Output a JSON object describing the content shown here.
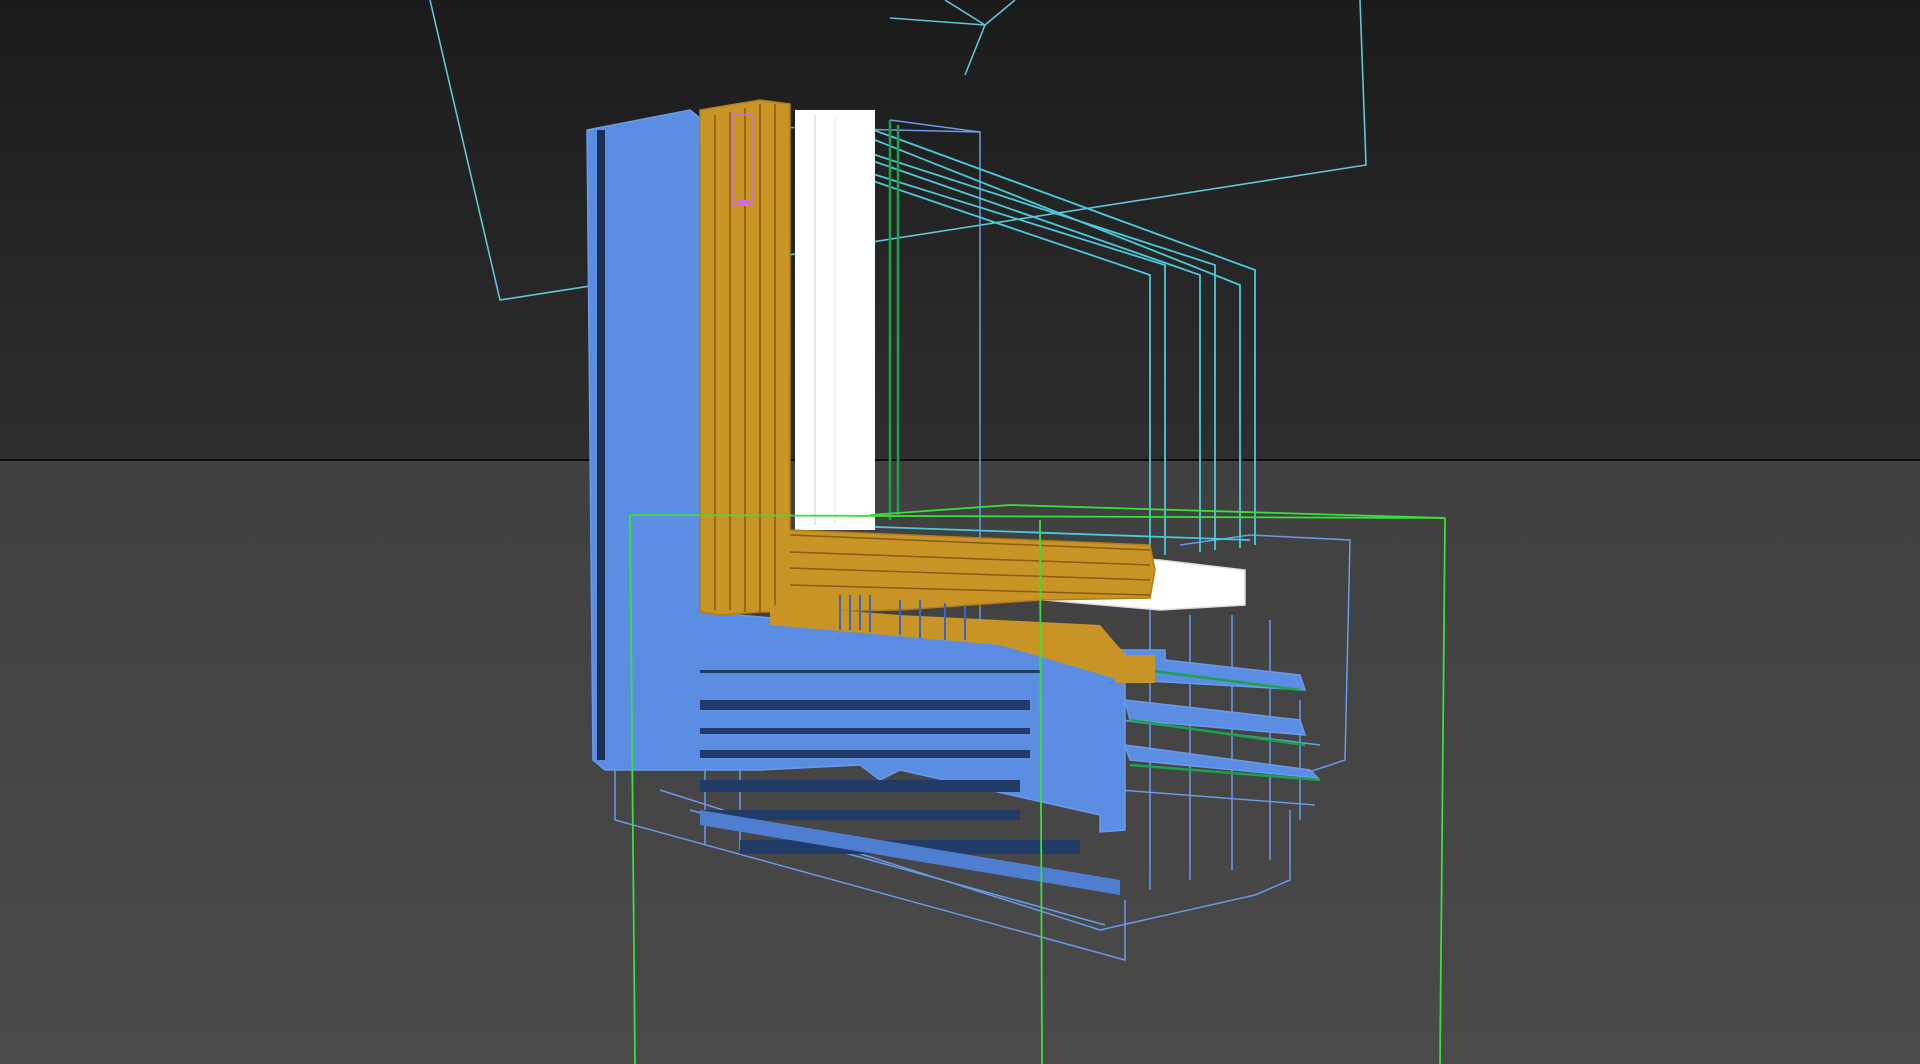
{
  "viewport": {
    "view_mode": "perspective",
    "shading": "wireframe-over-shaded",
    "horizon_grid": true
  },
  "colors": {
    "sky_top": "#1b1b1b",
    "sky_bottom": "#2e2e2e",
    "ground_top": "#404040",
    "ground_bottom": "#4a4a4a",
    "horizon_line": "#0c0c0c",
    "frame_profile": "#5b8ee2",
    "frame_edges": "#6a9ae8",
    "sash_gold": "#c99426",
    "sash_dark_gold": "#8a5a10",
    "glazing_white": "#ffffff",
    "glass_edges": "#49c9dc",
    "gasket_green": "#1aa34a",
    "selection_box": "#39e039",
    "camera_gizmo": "#5fc6d8",
    "accent_pink": "#d26fd8"
  },
  "scene_objects": [
    {
      "name": "window-frame-profile",
      "color": "frame_profile"
    },
    {
      "name": "sash-profile",
      "color": "sash_gold"
    },
    {
      "name": "glazing-unit",
      "color": "glazing_white"
    },
    {
      "name": "glass-panes",
      "color": "glass_edges"
    },
    {
      "name": "gaskets",
      "color": "gasket_green"
    },
    {
      "name": "selection-bounding-box",
      "color": "selection_box"
    },
    {
      "name": "camera-target",
      "color": "camera_gizmo"
    }
  ]
}
